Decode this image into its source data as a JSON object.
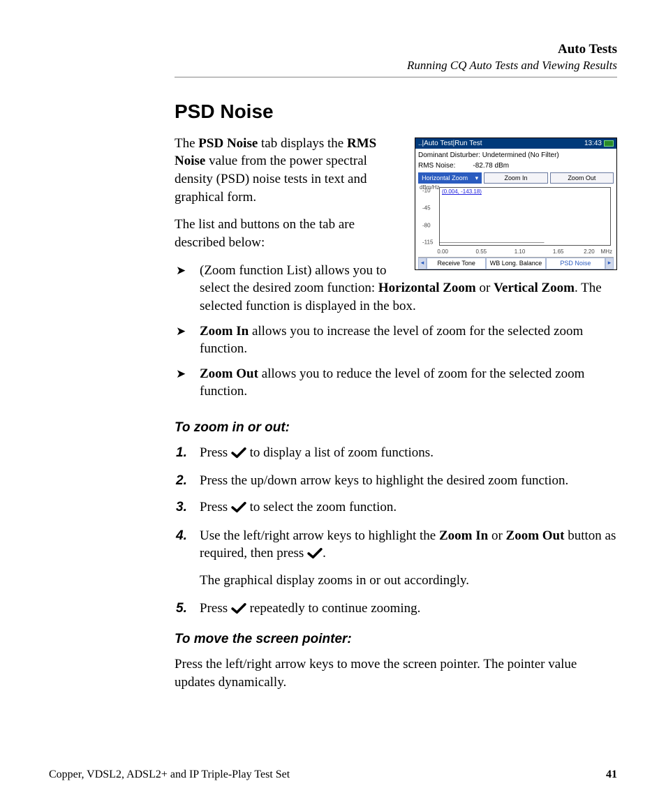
{
  "header": {
    "title": "Auto Tests",
    "subtitle": "Running CQ Auto Tests and Viewing Results"
  },
  "section_title": "PSD Noise",
  "intro_part1": "The ",
  "intro_b1": "PSD Noise",
  "intro_part2": " tab displays the ",
  "intro_b2": "RMS Noise",
  "intro_part3": " value from the power spectral density (PSD) noise tests in text and graphical form.",
  "intro2": "The list and buttons on the tab are described below:",
  "bullet1_a": "(Zoom function List) allows you to select the desired zoom function: ",
  "bullet1_b1": "Horizontal Zoom",
  "bullet1_or": " or ",
  "bullet1_b2": "Vertical Zoom",
  "bullet1_c": ". The selected function is displayed in the box.",
  "bullet2_b": "Zoom In",
  "bullet2_t": " allows you to increase the level of zoom for the selected zoom function.",
  "bullet3_b": "Zoom Out",
  "bullet3_t": " allows you to reduce the level of zoom for the selected zoom function.",
  "sub1": "To zoom in or out:",
  "step1_a": "Press ",
  "step1_b": " to display a list of zoom functions.",
  "step2": "Press the up/down arrow keys to highlight the desired zoom function.",
  "step3_a": "Press ",
  "step3_b": " to select the zoom function.",
  "step4_a": "Use the left/right arrow keys to highlight the ",
  "step4_b1": "Zoom In",
  "step4_or": " or ",
  "step4_b2": "Zoom Out",
  "step4_c": " button as required, then press ",
  "step4_d": ".",
  "step4_p2": "The graphical display zooms in or out accordingly.",
  "step5_a": "Press ",
  "step5_b": " repeatedly to continue zooming.",
  "sub2": "To move the screen pointer:",
  "move_text": "Press the left/right arrow keys to move the screen pointer. The pointer value updates dynamically.",
  "footer": {
    "left": "Copper, VDSL2, ADSL2+ and IP Triple-Play Test Set",
    "page": "41"
  },
  "screenshot": {
    "breadcrumb": "..|Auto Test|Run Test",
    "time": "13:43",
    "dominant": "Dominant Disturber: Undetermined  (No Filter)",
    "rms_label": "RMS Noise:",
    "rms_value": "-82.78 dBm",
    "zoom_select": "Horizontal Zoom",
    "zoom_in": "Zoom In",
    "zoom_out": "Zoom Out",
    "y_unit": "dBm/Hz",
    "y_ticks": [
      "-10",
      "-45",
      "-80",
      "-115"
    ],
    "coord": "(0.004, -143.18)",
    "x_ticks": [
      "0.00",
      "0.55",
      "1.10",
      "1.65",
      "2.20"
    ],
    "x_unit": "MHz",
    "tabs": [
      "Receive Tone",
      "WB Long. Balance",
      "PSD Noise"
    ]
  },
  "chart_data": {
    "type": "line",
    "title": "PSD Noise",
    "xlabel": "MHz",
    "ylabel": "dBm/Hz",
    "xlim": [
      0.0,
      2.2
    ],
    "ylim": [
      -150,
      -10
    ],
    "x_ticks": [
      0.0,
      0.55,
      1.1,
      1.65,
      2.2
    ],
    "y_ticks": [
      -10,
      -45,
      -80,
      -115
    ],
    "cursor": {
      "x": 0.004,
      "y": -143.18
    },
    "series": [
      {
        "name": "PSD Noise",
        "approx_level_dbm_per_hz": -143,
        "note": "flat noise floor across band"
      }
    ]
  }
}
